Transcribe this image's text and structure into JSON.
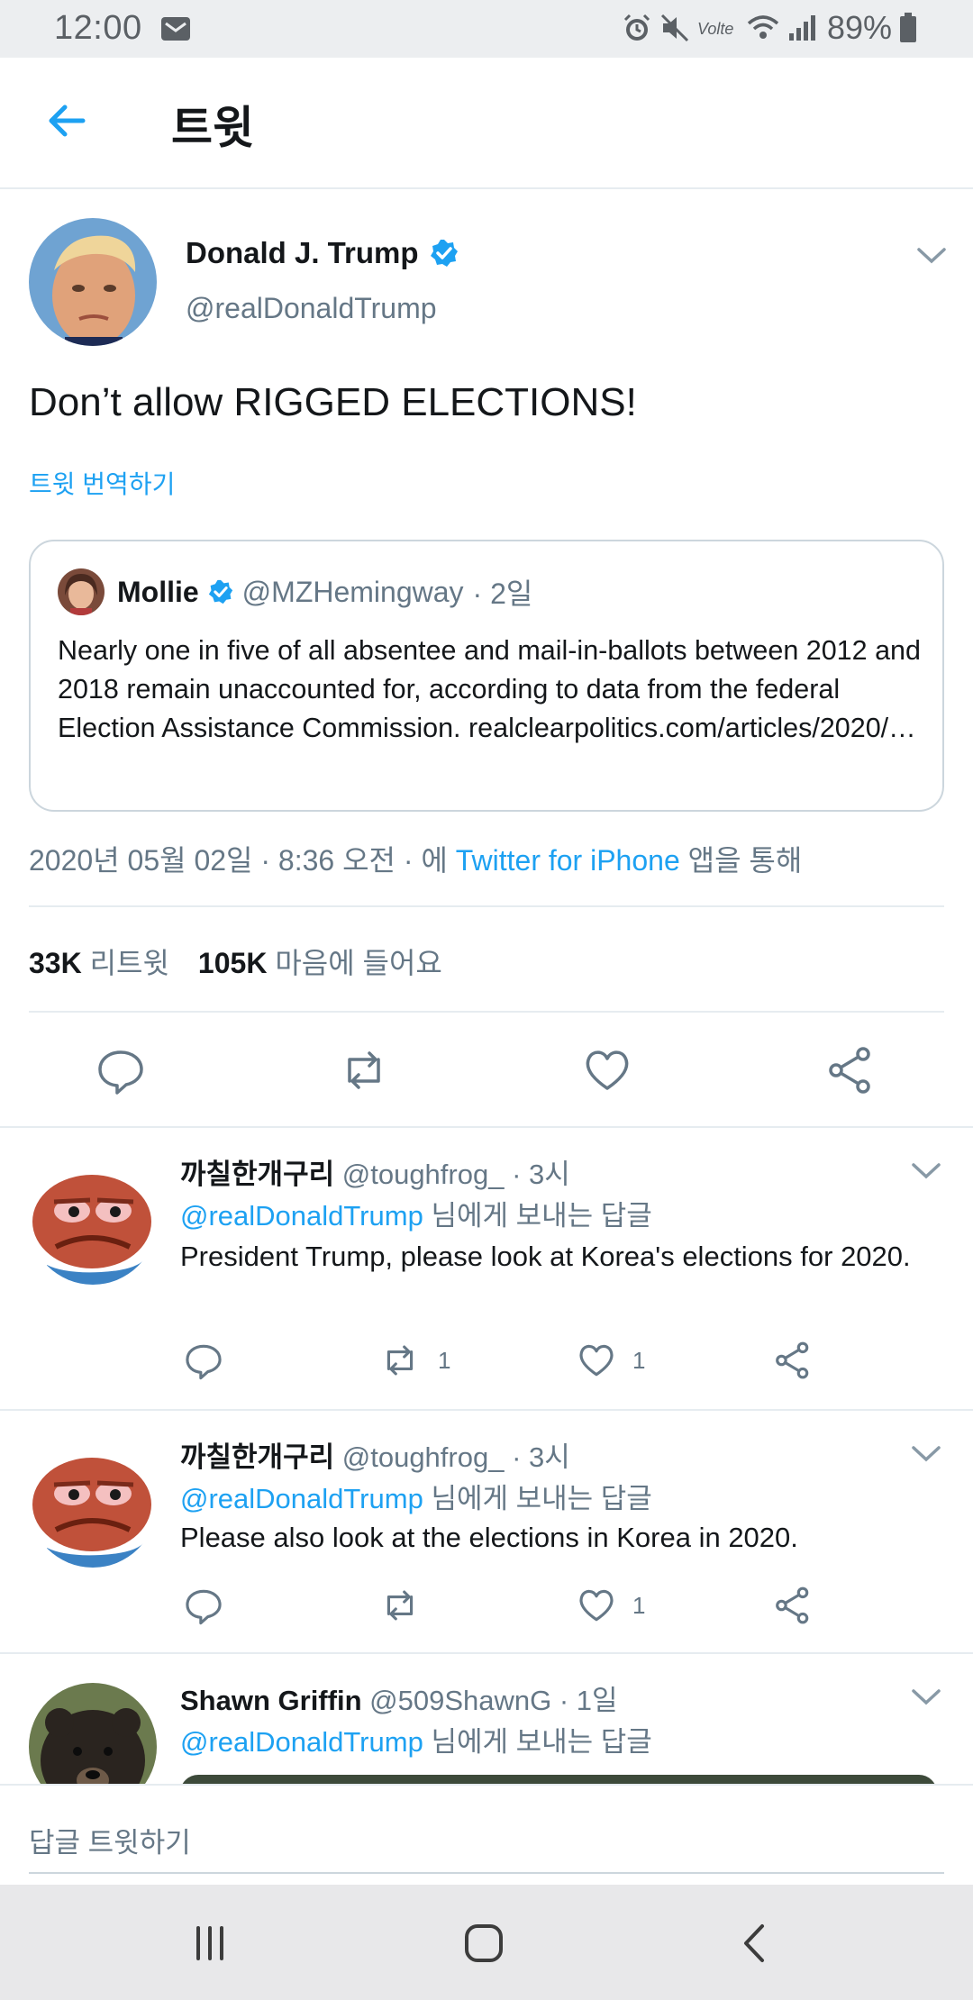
{
  "status_bar": {
    "time": "12:00",
    "battery_percent": "89%",
    "icons": [
      "mail-icon",
      "alarm-icon",
      "mute-icon",
      "volte-icon",
      "wifi-icon",
      "signal-icon",
      "battery-icon"
    ]
  },
  "header": {
    "title": "트윗",
    "back_icon": "arrow-left-icon"
  },
  "tweet": {
    "author_name": "Donald J. Trump",
    "author_handle": "@realDonaldTrump",
    "verified": true,
    "text": "Don’t allow RIGGED ELECTIONS!",
    "translate_label": "트윗 번역하기",
    "quote": {
      "name": "Mollie",
      "handle": "@MZHemingway",
      "age": "· 2일",
      "text": "Nearly one in five of all absentee and mail-in-ballots between 2012 and 2018 remain unaccounted for, according to data from the federal Election Assistance Commission. realclearpolitics.com/articles/2020/…"
    },
    "meta_prefix": "2020년 05월 02일 · 8:36 오전 · 에",
    "meta_client": "Twitter for iPhone",
    "meta_suffix": "앱을 통해",
    "retweets_count": "33K",
    "retweets_label": "리트윗",
    "likes_count": "105K",
    "likes_label": "마음에 들어요"
  },
  "replies": [
    {
      "name": "까칠한개구리",
      "handle": "@toughfrog_",
      "age": "· 3시",
      "to_handle": "@realDonaldTrump",
      "to_suffix": "님에게 보내는 답글",
      "text": "President Trump, please look at Korea's elections for 2020.",
      "retweets": "1",
      "likes": "1"
    },
    {
      "name": "까칠한개구리",
      "handle": "@toughfrog_",
      "age": "· 3시",
      "to_handle": "@realDonaldTrump",
      "to_suffix": "님에게 보내는 답글",
      "text": "Please also look at the elections in Korea in 2020.",
      "retweets": "",
      "likes": "1"
    },
    {
      "name": "Shawn Griffin",
      "handle": "@509ShawnG",
      "age": "· 1일",
      "to_handle": "@realDonaldTrump",
      "to_suffix": "님에게 보내는 답글"
    }
  ],
  "composer": {
    "placeholder": "답글 트윗하기"
  },
  "colors": {
    "accent": "#1da1f2",
    "muted_text": "#657786",
    "text": "#14171a",
    "divider": "#e6ecf0"
  }
}
